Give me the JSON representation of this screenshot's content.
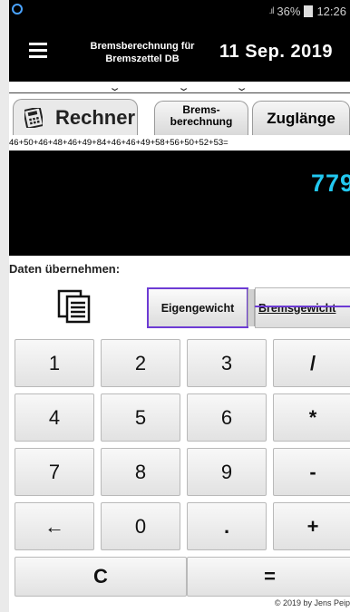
{
  "status_bar": {
    "battery": "36%",
    "time": "12:26"
  },
  "header": {
    "title": "Bremsberechnung für\nBremszettel DB",
    "date": "11 Sep. 2019"
  },
  "tabs": {
    "rechner": "Rechner",
    "brems": "Brems-\nberechnung",
    "zuglaenge": "Zuglänge"
  },
  "calculator": {
    "expression": "46+50+46+48+46+49+84+46+46+49+58+56+50+52+53=",
    "result": "779"
  },
  "transfer": {
    "label": "Daten übernehmen:",
    "eigengewicht": "Eigengewicht",
    "bremsgewicht": "Bremsgewicht"
  },
  "keys": {
    "k1": "1",
    "k2": "2",
    "k3": "3",
    "div": "/",
    "k4": "4",
    "k5": "5",
    "k6": "6",
    "mul": "*",
    "k7": "7",
    "k8": "8",
    "k9": "9",
    "sub": "-",
    "back": "←",
    "k0": "0",
    "dot": ".",
    "add": "+",
    "clear": "C",
    "equals": "="
  },
  "footer": "© 2019 by Jens Peip",
  "colors": {
    "accent": "#6d3bd4",
    "result": "#22c8f0"
  }
}
